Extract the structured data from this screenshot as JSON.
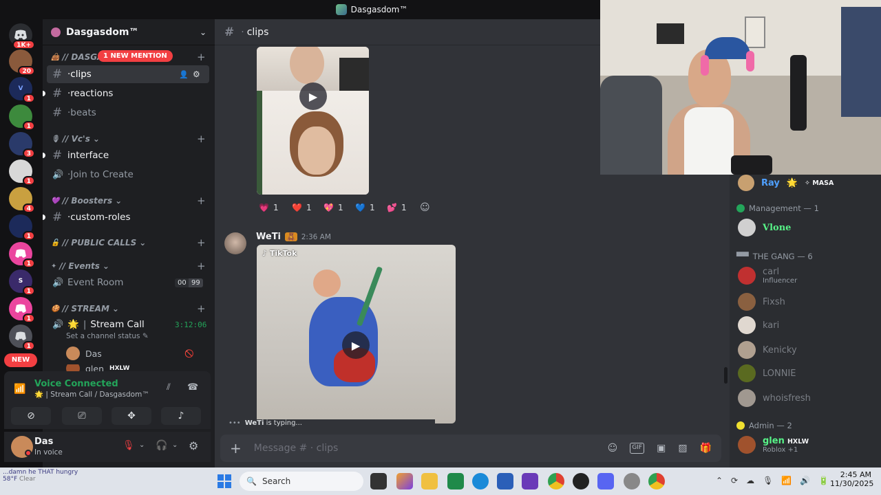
{
  "window": {
    "title": "Dasgasdom™"
  },
  "rail": {
    "servers": [
      {
        "badge": "1K+",
        "color": "#2b2d31"
      },
      {
        "badge": "20",
        "color": "#8a5a3c"
      },
      {
        "badge": "1",
        "color": "#2c4a9a"
      },
      {
        "badge": "1",
        "color": "#3d8a3d"
      },
      {
        "badge": "3",
        "color": "#2a3a6a"
      },
      {
        "badge": "1",
        "color": "#d8d8d8"
      },
      {
        "badge": "4",
        "color": "#c9a040"
      },
      {
        "badge": "1",
        "color": "#1c2a5a"
      },
      {
        "badge": "1",
        "color": "#eb459e"
      },
      {
        "badge": "1",
        "color": "#3a2a6a"
      },
      {
        "badge": "1",
        "color": "#eb459e"
      },
      {
        "badge": "1",
        "color": "#4e5058"
      }
    ],
    "new_label": "NEW"
  },
  "sidebar": {
    "server_name": "Dasgasdom™",
    "mention_pill": "1 NEW MENTION",
    "categories": {
      "dasga": "// DASGA",
      "vcs": "// Vc's",
      "boosters": "// Boosters",
      "public_calls": "// PUBLIC CALLS",
      "events": "// Events",
      "stream": "// STREAM"
    },
    "channels": {
      "clips": "clips",
      "reactions": "reactions",
      "beats": "beats",
      "interface": "interface",
      "join_to_create": "Join to Create",
      "custom_roles": "custom-roles",
      "event_room": "Event Room",
      "event_room_count_a": "00",
      "event_room_count_b": "99",
      "stream_call": "Stream Call",
      "stream_timer": "3:12:06",
      "stream_status": "Set a channel status"
    },
    "voice_users": [
      {
        "name": "Das"
      },
      {
        "name": "glen",
        "tag": "HXLW"
      }
    ],
    "voice_panel": {
      "status": "Voice Connected",
      "location": "Stream Call / Dasgasdom™"
    },
    "user": {
      "name": "Das",
      "status": "In voice"
    }
  },
  "chat": {
    "channel": "clips",
    "message": {
      "author": "WeTi",
      "time": "2:36 AM",
      "tiktok_label": "TikTok"
    },
    "reactions": [
      {
        "emoji": "💗",
        "count": "1"
      },
      {
        "emoji": "❤️",
        "count": "1"
      },
      {
        "emoji": "💖",
        "count": "1"
      },
      {
        "emoji": "💙",
        "count": "1"
      },
      {
        "emoji": "💕",
        "count": "1"
      }
    ],
    "typing": "WeTi is typing...",
    "typing_name": "WeTi",
    "typing_suffix": " is typing...",
    "composer_placeholder": "Message # · clips"
  },
  "members": {
    "top": {
      "name": "Ray",
      "tag": "MASA"
    },
    "categories": {
      "management": "Management — 1",
      "gang": "THE GANG — 6",
      "admin": "Admin — 2"
    },
    "management": [
      {
        "name": "Vlone",
        "color": "#57f287"
      }
    ],
    "gang": [
      {
        "name": "carl",
        "sub": "Influencer"
      },
      {
        "name": "Fixsh"
      },
      {
        "name": "kari"
      },
      {
        "name": "Kenicky"
      },
      {
        "name": "LONNIE"
      },
      {
        "name": "whoisfresh"
      }
    ],
    "admin": [
      {
        "name": "glen",
        "tag": "HXLW",
        "sub": "Roblox +1"
      }
    ]
  },
  "taskbar": {
    "search": "Search",
    "weather_temp": "58°F",
    "weather_desc": "Clear",
    "ticker": "...damn he THAT hungry",
    "time": "2:45 AM",
    "date": "11/30/2025"
  },
  "colors": {
    "accent": "#5865f2",
    "danger": "#f23f42",
    "online": "#23a55a"
  }
}
